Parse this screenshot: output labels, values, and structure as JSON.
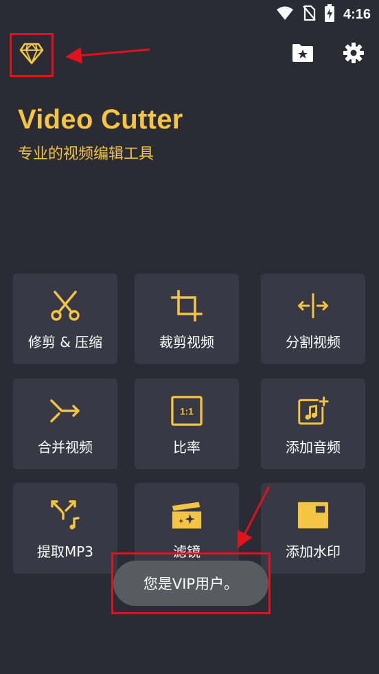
{
  "status_bar": {
    "time": "4:16",
    "icons": [
      "wifi-icon",
      "no-sim-icon",
      "battery-charging-icon"
    ]
  },
  "header": {
    "vip_icon": "diamond-icon",
    "folder_icon": "starred-folder-icon",
    "settings_icon": "gear-icon"
  },
  "app": {
    "title": "Video Cutter",
    "subtitle": "专业的视频编辑工具"
  },
  "tools": [
    {
      "label": "修剪 & 压缩",
      "icon": "scissors-icon"
    },
    {
      "label": "裁剪视频",
      "icon": "crop-icon"
    },
    {
      "label": "分割视频",
      "icon": "split-icon"
    },
    {
      "label": "合并视频",
      "icon": "merge-icon"
    },
    {
      "label": "比率",
      "icon": "ratio-icon"
    },
    {
      "label": "添加音频",
      "icon": "add-music-icon"
    },
    {
      "label": "提取MP3",
      "icon": "extract-mp3-icon"
    },
    {
      "label": "滤镜",
      "icon": "filter-icon"
    },
    {
      "label": "添加水印",
      "icon": "watermark-icon"
    }
  ],
  "toast": {
    "message": "您是VIP用户。"
  },
  "colors": {
    "background": "#2a2b35",
    "tile": "#383945",
    "accent": "#f4c542",
    "annotation": "#e0121b",
    "toast": "#5a5b61"
  }
}
